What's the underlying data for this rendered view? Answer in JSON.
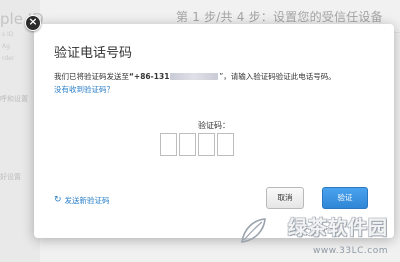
{
  "background": {
    "apple_id_partial": "ple ID",
    "sidebar_lines": [
      "",
      "s ID",
      "Ag",
      "rder"
    ],
    "sidebar_items": [
      "呼和设置",
      "好设置"
    ],
    "step_title": "第 1 步/共 4 步：设置您的受信任设备"
  },
  "dialog": {
    "close_icon": "close-icon",
    "title": "验证电话号码",
    "message_prefix": "我们已将验证码发送至",
    "phone_visible": "“+86-131",
    "phone_suffix": "”，请输入验证码验证此电话号码。",
    "no_code_link": "没有收到验证码？",
    "code_label": "验证码：",
    "code_boxes": [
      "",
      "",
      "",
      ""
    ],
    "resend_icon": "refresh-icon",
    "resend_label": "发送新验证码",
    "cancel_label": "取消",
    "verify_label": "验证"
  },
  "watermark": {
    "name": "绿茶软件园",
    "url": "www.33LC.com"
  },
  "colors": {
    "accent": "#2a7fc8",
    "verify_button": "#3a92e0"
  }
}
